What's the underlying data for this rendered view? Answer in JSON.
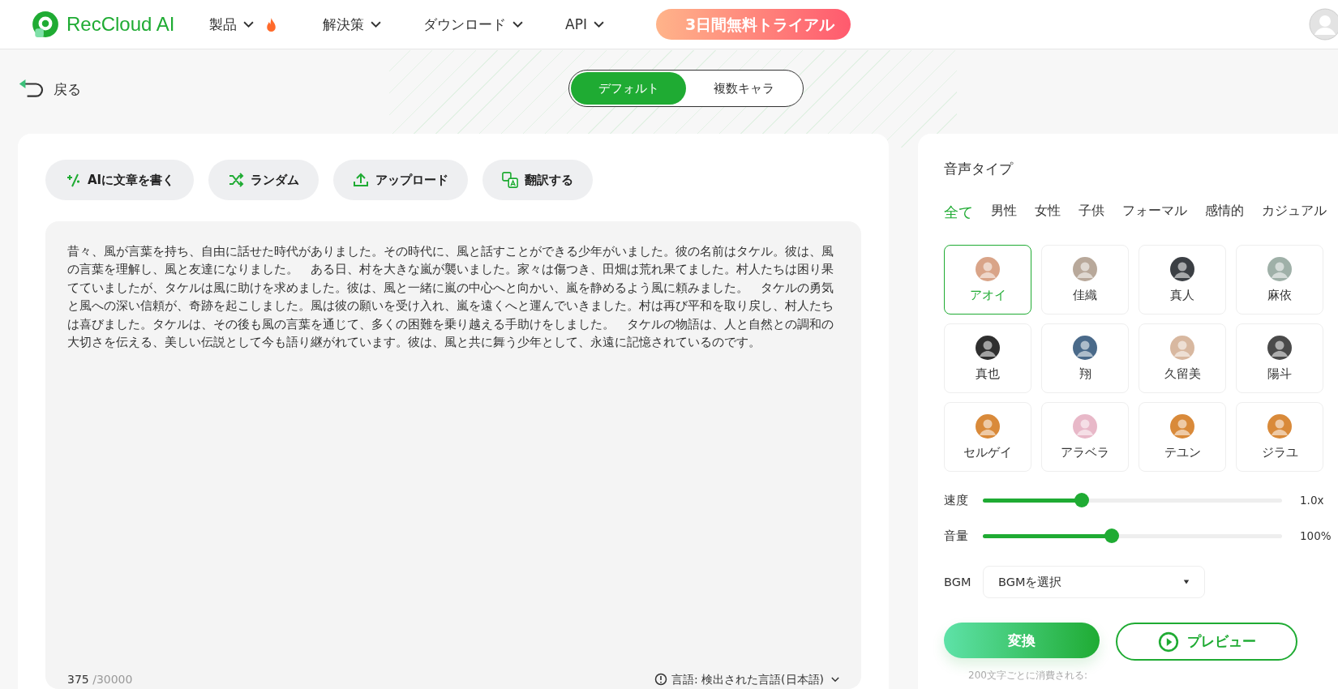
{
  "header": {
    "logo": "RecCloud AI",
    "nav": [
      {
        "label": "製品",
        "hot": true
      },
      {
        "label": "解決策",
        "hot": false
      },
      {
        "label": "ダウンロード",
        "hot": false
      },
      {
        "label": "API",
        "hot": false
      }
    ],
    "trial_banner": "3日間無料トライアル"
  },
  "back_link": "戻る",
  "mode_tabs": [
    {
      "label": "デフォルト",
      "selected": true
    },
    {
      "label": "複数キャラ",
      "selected": false
    }
  ],
  "tools": [
    {
      "label": "AIに文章を書く",
      "kind": "magic"
    },
    {
      "label": "ランダム",
      "kind": "shuffle"
    },
    {
      "label": "アップロード",
      "kind": "upload"
    },
    {
      "label": "翻訳する",
      "kind": "translate"
    }
  ],
  "editor": {
    "text": "昔々、風が言葉を持ち、自由に話せた時代がありました。その時代に、風と話すことができる少年がいました。彼の名前はタケル。彼は、風の言葉を理解し、風と友達になりました。　ある日、村を大きな嵐が襲いました。家々は傷つき、田畑は荒れ果てました。村人たちは困り果てていましたが、タケルは風に助けを求めました。彼は、風と一緒に嵐の中心へと向かい、嵐を静めるよう風に頼みました。　タケルの勇気と風への深い信頼が、奇跡を起こしました。風は彼の願いを受け入れ、嵐を遠くへと運んでいきました。村は再び平和を取り戻し、村人たちは喜びました。タケルは、その後も風の言葉を通じて、多くの困難を乗り越える手助けをしました。　タケルの物語は、人と自然との調和の大切さを伝える、美しい伝説として今も語り継がれています。彼は、風と共に舞う少年として、永遠に記憶されているのです。",
    "count": "375",
    "limit": "/30000",
    "language": "言語: 検出された言語(日本語)"
  },
  "voice_panel": {
    "title": "音声タイプ",
    "filters": [
      {
        "label": "全て",
        "selected": true
      },
      {
        "label": "男性",
        "selected": false
      },
      {
        "label": "女性",
        "selected": false
      },
      {
        "label": "子供",
        "selected": false
      },
      {
        "label": "フォーマル",
        "selected": false
      },
      {
        "label": "感情的",
        "selected": false
      },
      {
        "label": "カジュアル",
        "selected": false
      }
    ],
    "voices": [
      {
        "name": "アオイ",
        "selected": true,
        "color": "#d9a488"
      },
      {
        "name": "佳織",
        "selected": false,
        "color": "#b8a89a"
      },
      {
        "name": "真人",
        "selected": false,
        "color": "#3b3f44"
      },
      {
        "name": "麻依",
        "selected": false,
        "color": "#9fb0a8"
      },
      {
        "name": "真也",
        "selected": false,
        "color": "#2f2f2f"
      },
      {
        "name": "翔",
        "selected": false,
        "color": "#4a6a8a"
      },
      {
        "name": "久留美",
        "selected": false,
        "color": "#d8b8a0"
      },
      {
        "name": "陽斗",
        "selected": false,
        "color": "#4a4a4a"
      },
      {
        "name": "セルゲイ",
        "selected": false,
        "color": "#d98a3a"
      },
      {
        "name": "アラベラ",
        "selected": false,
        "color": "#e8b8c8"
      },
      {
        "name": "テユン",
        "selected": false,
        "color": "#d98a3a"
      },
      {
        "name": "ジラユ",
        "selected": false,
        "color": "#d98a3a"
      }
    ],
    "sliders": [
      {
        "label": "速度",
        "level": 0.33,
        "reading": "1.0x"
      },
      {
        "label": "音量",
        "level": 0.43,
        "reading": "100%"
      }
    ],
    "bgm": {
      "label": "BGM",
      "placeholder": "BGMを選択"
    },
    "convert_button": "変換",
    "preview_button": "プレビュー",
    "note": "200文字ごとに消費される:"
  }
}
